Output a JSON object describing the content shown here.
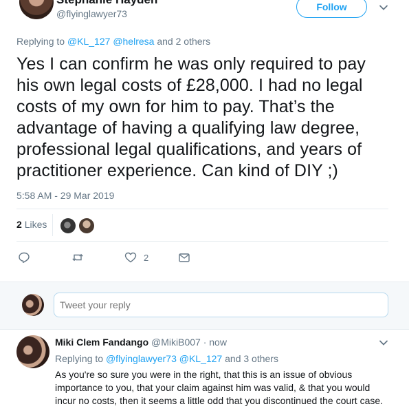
{
  "header": {
    "display_name": "Stephanie Hayden",
    "handle": "@flyinglawyer73",
    "follow_label": "Follow"
  },
  "tweet": {
    "replying_prefix": "Replying to",
    "replying_users": [
      "@KL_127",
      "@helresa"
    ],
    "replying_suffix": "and 2 others",
    "text": "Yes I can confirm he was only required to pay his own legal costs of £28,000. I had no legal costs of my own for him to pay. That’s the advantage of having a qualifying law degree, professional legal qualifications, and years of practitioner experience. Can kind of DIY ;)",
    "timestamp": "5:58 AM - 29 Mar 2019",
    "likes_count": "2",
    "likes_label": "Likes",
    "like_action_count": "2"
  },
  "composer": {
    "placeholder": "Tweet your reply"
  },
  "reply": {
    "display_name": "Miki Clem Fandango",
    "handle": "@MikiB007",
    "separator": "·",
    "time": "now",
    "replying_prefix": "Replying to",
    "replying_users": [
      "@flyinglawyer73",
      "@KL_127"
    ],
    "replying_suffix": "and 3 others",
    "text": "As you're so sure you were in the right, that this is an issue of obvious importance to you, that your claim against him was valid, & that you would incur no costs, then it seems a little odd that you discontinued the court case."
  },
  "colors": {
    "accent": "#1da1f2",
    "muted": "#657786",
    "text": "#14171a",
    "divider": "#e6ecf0"
  }
}
